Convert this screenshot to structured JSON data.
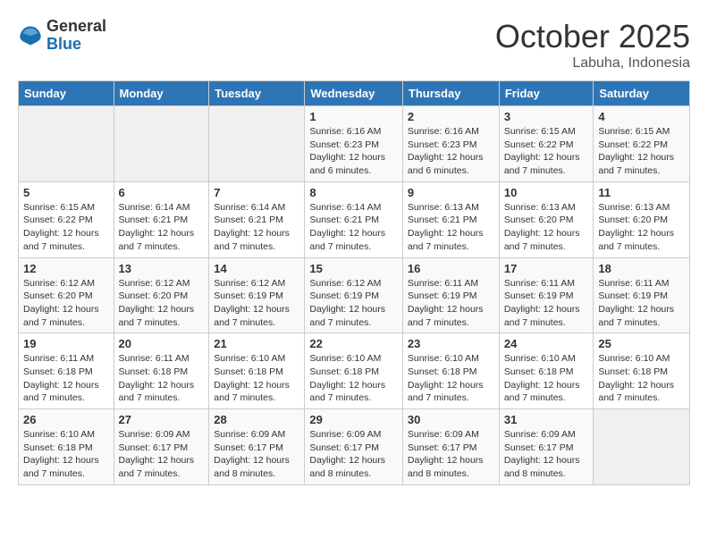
{
  "logo": {
    "general": "General",
    "blue": "Blue"
  },
  "title": "October 2025",
  "location": "Labuha, Indonesia",
  "days_header": [
    "Sunday",
    "Monday",
    "Tuesday",
    "Wednesday",
    "Thursday",
    "Friday",
    "Saturday"
  ],
  "weeks": [
    [
      {
        "day": "",
        "info": ""
      },
      {
        "day": "",
        "info": ""
      },
      {
        "day": "",
        "info": ""
      },
      {
        "day": "1",
        "info": "Sunrise: 6:16 AM\nSunset: 6:23 PM\nDaylight: 12 hours\nand 6 minutes."
      },
      {
        "day": "2",
        "info": "Sunrise: 6:16 AM\nSunset: 6:23 PM\nDaylight: 12 hours\nand 6 minutes."
      },
      {
        "day": "3",
        "info": "Sunrise: 6:15 AM\nSunset: 6:22 PM\nDaylight: 12 hours\nand 7 minutes."
      },
      {
        "day": "4",
        "info": "Sunrise: 6:15 AM\nSunset: 6:22 PM\nDaylight: 12 hours\nand 7 minutes."
      }
    ],
    [
      {
        "day": "5",
        "info": "Sunrise: 6:15 AM\nSunset: 6:22 PM\nDaylight: 12 hours\nand 7 minutes."
      },
      {
        "day": "6",
        "info": "Sunrise: 6:14 AM\nSunset: 6:21 PM\nDaylight: 12 hours\nand 7 minutes."
      },
      {
        "day": "7",
        "info": "Sunrise: 6:14 AM\nSunset: 6:21 PM\nDaylight: 12 hours\nand 7 minutes."
      },
      {
        "day": "8",
        "info": "Sunrise: 6:14 AM\nSunset: 6:21 PM\nDaylight: 12 hours\nand 7 minutes."
      },
      {
        "day": "9",
        "info": "Sunrise: 6:13 AM\nSunset: 6:21 PM\nDaylight: 12 hours\nand 7 minutes."
      },
      {
        "day": "10",
        "info": "Sunrise: 6:13 AM\nSunset: 6:20 PM\nDaylight: 12 hours\nand 7 minutes."
      },
      {
        "day": "11",
        "info": "Sunrise: 6:13 AM\nSunset: 6:20 PM\nDaylight: 12 hours\nand 7 minutes."
      }
    ],
    [
      {
        "day": "12",
        "info": "Sunrise: 6:12 AM\nSunset: 6:20 PM\nDaylight: 12 hours\nand 7 minutes."
      },
      {
        "day": "13",
        "info": "Sunrise: 6:12 AM\nSunset: 6:20 PM\nDaylight: 12 hours\nand 7 minutes."
      },
      {
        "day": "14",
        "info": "Sunrise: 6:12 AM\nSunset: 6:19 PM\nDaylight: 12 hours\nand 7 minutes."
      },
      {
        "day": "15",
        "info": "Sunrise: 6:12 AM\nSunset: 6:19 PM\nDaylight: 12 hours\nand 7 minutes."
      },
      {
        "day": "16",
        "info": "Sunrise: 6:11 AM\nSunset: 6:19 PM\nDaylight: 12 hours\nand 7 minutes."
      },
      {
        "day": "17",
        "info": "Sunrise: 6:11 AM\nSunset: 6:19 PM\nDaylight: 12 hours\nand 7 minutes."
      },
      {
        "day": "18",
        "info": "Sunrise: 6:11 AM\nSunset: 6:19 PM\nDaylight: 12 hours\nand 7 minutes."
      }
    ],
    [
      {
        "day": "19",
        "info": "Sunrise: 6:11 AM\nSunset: 6:18 PM\nDaylight: 12 hours\nand 7 minutes."
      },
      {
        "day": "20",
        "info": "Sunrise: 6:11 AM\nSunset: 6:18 PM\nDaylight: 12 hours\nand 7 minutes."
      },
      {
        "day": "21",
        "info": "Sunrise: 6:10 AM\nSunset: 6:18 PM\nDaylight: 12 hours\nand 7 minutes."
      },
      {
        "day": "22",
        "info": "Sunrise: 6:10 AM\nSunset: 6:18 PM\nDaylight: 12 hours\nand 7 minutes."
      },
      {
        "day": "23",
        "info": "Sunrise: 6:10 AM\nSunset: 6:18 PM\nDaylight: 12 hours\nand 7 minutes."
      },
      {
        "day": "24",
        "info": "Sunrise: 6:10 AM\nSunset: 6:18 PM\nDaylight: 12 hours\nand 7 minutes."
      },
      {
        "day": "25",
        "info": "Sunrise: 6:10 AM\nSunset: 6:18 PM\nDaylight: 12 hours\nand 7 minutes."
      }
    ],
    [
      {
        "day": "26",
        "info": "Sunrise: 6:10 AM\nSunset: 6:18 PM\nDaylight: 12 hours\nand 7 minutes."
      },
      {
        "day": "27",
        "info": "Sunrise: 6:09 AM\nSunset: 6:17 PM\nDaylight: 12 hours\nand 7 minutes."
      },
      {
        "day": "28",
        "info": "Sunrise: 6:09 AM\nSunset: 6:17 PM\nDaylight: 12 hours\nand 8 minutes."
      },
      {
        "day": "29",
        "info": "Sunrise: 6:09 AM\nSunset: 6:17 PM\nDaylight: 12 hours\nand 8 minutes."
      },
      {
        "day": "30",
        "info": "Sunrise: 6:09 AM\nSunset: 6:17 PM\nDaylight: 12 hours\nand 8 minutes."
      },
      {
        "day": "31",
        "info": "Sunrise: 6:09 AM\nSunset: 6:17 PM\nDaylight: 12 hours\nand 8 minutes."
      },
      {
        "day": "",
        "info": ""
      }
    ]
  ]
}
